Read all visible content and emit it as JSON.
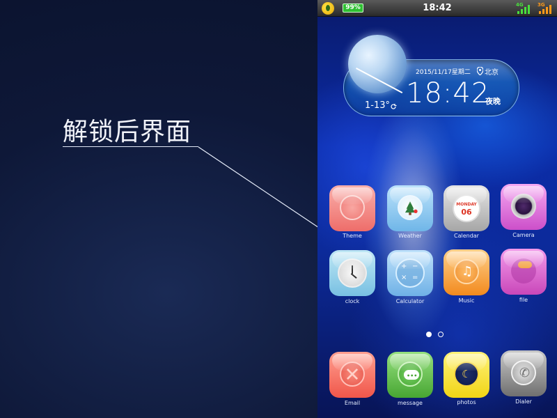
{
  "annotation": {
    "text": "解锁后界面"
  },
  "status_bar": {
    "battery": "99%",
    "time": "18:42",
    "network_1": "4G",
    "network_2": "3G",
    "colors": {
      "battery": "#2fbf32",
      "network_1": "#49e03c",
      "network_2": "#ff9a1a"
    }
  },
  "clock_widget": {
    "date": "2015/11/17星期二",
    "city": "北京",
    "time": "18:42",
    "period": "夜晚",
    "temperature": "1-13°"
  },
  "apps_row1": [
    {
      "label": "Theme",
      "icon": "theme-icon",
      "color": "#f2807d"
    },
    {
      "label": "Weather",
      "icon": "weather-icon",
      "color": "#8cc9ee"
    },
    {
      "label": "Calendar",
      "icon": "calendar-icon",
      "color": "#b9b9b9"
    },
    {
      "label": "Camera",
      "icon": "camera-icon",
      "color": "#e078e0"
    }
  ],
  "apps_row2": [
    {
      "label": "clock",
      "icon": "clock-icon",
      "color": "#8fd0ea"
    },
    {
      "label": "Calculator",
      "icon": "calculator-icon",
      "color": "#8bc7ee"
    },
    {
      "label": "Music",
      "icon": "music-icon",
      "color": "#ff9a35"
    },
    {
      "label": "file",
      "icon": "file-icon",
      "color": "#e05fcc"
    }
  ],
  "calendar_icon": {
    "month": "MONDAY",
    "day": "06"
  },
  "pager": {
    "pages": 2,
    "active": 1
  },
  "dock": [
    {
      "label": "Email",
      "icon": "email-icon",
      "color": "#f46a5b"
    },
    {
      "label": "message",
      "icon": "message-icon",
      "color": "#5cc048"
    },
    {
      "label": "photos",
      "icon": "photos-icon",
      "color": "#f6e11f"
    },
    {
      "label": "Dialer",
      "icon": "dialer-icon",
      "color": "#8a8a8a"
    }
  ]
}
